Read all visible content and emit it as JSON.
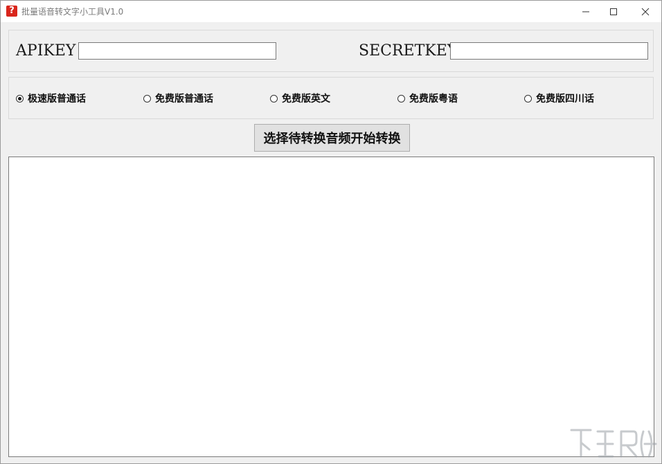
{
  "window": {
    "title": "批量语音转文字小工具V1.0",
    "icon_glyph": "?",
    "controls": [
      "minimize-icon",
      "maximize-icon",
      "close-icon"
    ]
  },
  "keys": {
    "api_label": "APIKEY",
    "api_value": "",
    "secret_label": "SECRETKEY",
    "secret_value": ""
  },
  "modes": {
    "selected_index": 0,
    "options": [
      "极速版普通话",
      "免费版普通话",
      "免费版英文",
      "免费版粤语",
      "免费版四川话"
    ]
  },
  "actions": {
    "convert_label": "选择待转换音频开始转换"
  },
  "output": {
    "text": ""
  },
  "colors": {
    "app_icon": "#d9261c",
    "window_bg": "#f0f0f0",
    "button_bg": "#e1e1e1"
  }
}
